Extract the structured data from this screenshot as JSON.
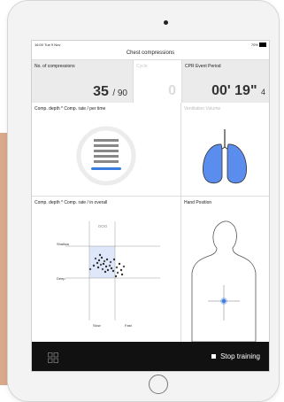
{
  "status": {
    "time": "16:00  Tue 9 Nov",
    "battery": "70%"
  },
  "header": {
    "title": "Chest compressions"
  },
  "stats": {
    "compressions": {
      "label": "No. of compressions",
      "value": "35",
      "total": "/ 90"
    },
    "cycle": {
      "label": "Cycle",
      "value": "0"
    },
    "event": {
      "label": "CPR Event Period",
      "value": "00' 19\"",
      "sub": "4"
    }
  },
  "panels": {
    "depth_per_time": {
      "label": "Comp. depth * Comp. rate / per time"
    },
    "ventilation": {
      "label": "Ventilation Volume"
    },
    "depth_overall": {
      "label": "Comp. depth * Comp. rate / in overall",
      "top_marker": "OOO",
      "shallow": "Shallow",
      "deep": "Deep",
      "slow": "Slow",
      "fast": "Fast"
    },
    "hand_position": {
      "label": "Hand Position"
    }
  },
  "footer": {
    "stop_label": "Stop training"
  },
  "colors": {
    "accent": "#3b7ddd",
    "lung": "#5b8def",
    "dark_bar": "#111111"
  }
}
